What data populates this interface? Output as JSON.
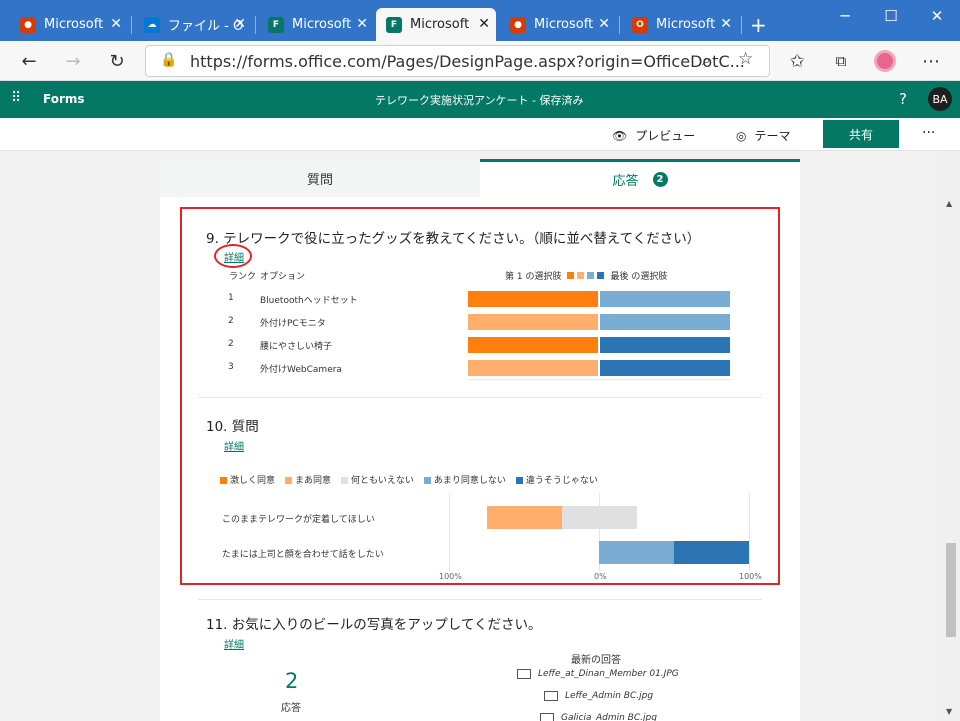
{
  "tabs": [
    {
      "label": "Microsoft",
      "color": "#d83b01",
      "glyph": "●"
    },
    {
      "label": "ファイル - O",
      "color": "#0078d4",
      "glyph": "☁"
    },
    {
      "label": "Microsoft",
      "color": "#077568",
      "glyph": "F"
    },
    {
      "label": "Microsoft",
      "color": "#077568",
      "glyph": "F"
    },
    {
      "label": "Microsoft",
      "color": "#d83b01",
      "glyph": "●"
    },
    {
      "label": "Microsoft",
      "color": "#d83b01",
      "glyph": "O"
    }
  ],
  "address": {
    "url": "https://forms.office.com/Pages/DesignPage.aspx?origin=OfficeDotC..."
  },
  "forms_header": {
    "app": "Forms",
    "title": "テレワーク実施状況アンケート - 保存済み",
    "help": "?",
    "avatar": "BA"
  },
  "cmdbar": {
    "preview": "プレビュー",
    "theme": "テーマ",
    "share": "共有",
    "more": "···"
  },
  "page_tabs": {
    "questions": "質問",
    "responses": "応答",
    "response_count": "2"
  },
  "q9": {
    "title": "9.  テレワークで役に立ったグッズを教えてください。（順に並べ替えてください）",
    "detail": "詳細",
    "col_rank": "ランク",
    "col_option": "オプション",
    "legend_first": "第 1 の選択肢",
    "legend_last": "最後 の選択肢",
    "rows": [
      {
        "rank": "1",
        "option": "Bluetoothヘッドセット"
      },
      {
        "rank": "2",
        "option": "外付けPCモニタ"
      },
      {
        "rank": "2",
        "option": "腰にやさしい椅子"
      },
      {
        "rank": "3",
        "option": "外付けWebCamera"
      }
    ],
    "colors": [
      "#ff7f0e",
      "#ffae6b",
      "#7aadd4",
      "#2b75b5"
    ]
  },
  "q10": {
    "title": "10.  質問",
    "detail": "詳細",
    "legend": [
      {
        "label": "激しく同意",
        "color": "#ff7f0e"
      },
      {
        "label": "まあ同意",
        "color": "#ffae6b"
      },
      {
        "label": "何ともいえない",
        "color": "#e0e0e0"
      },
      {
        "label": "あまり同意しない",
        "color": "#7aadd4"
      },
      {
        "label": "違うそうじゃない",
        "color": "#2b75b5"
      }
    ],
    "statements": [
      {
        "label": "このままテレワークが定着してほしい"
      },
      {
        "label": "たまには上司と顔を合わせて話をしたい"
      }
    ],
    "axis": [
      "100%",
      "0%",
      "100%"
    ]
  },
  "q11": {
    "title": "11.  お気に入りのビールの写真をアップしてください。",
    "detail": "詳細",
    "count": "2",
    "count_label": "応答",
    "latest_label": "最新の回答",
    "files": [
      "Leffe_at_Dinan_Member 01.JPG",
      "Leffe_Admin BC.jpg",
      "Galicia_Admin BC.jpg"
    ]
  }
}
